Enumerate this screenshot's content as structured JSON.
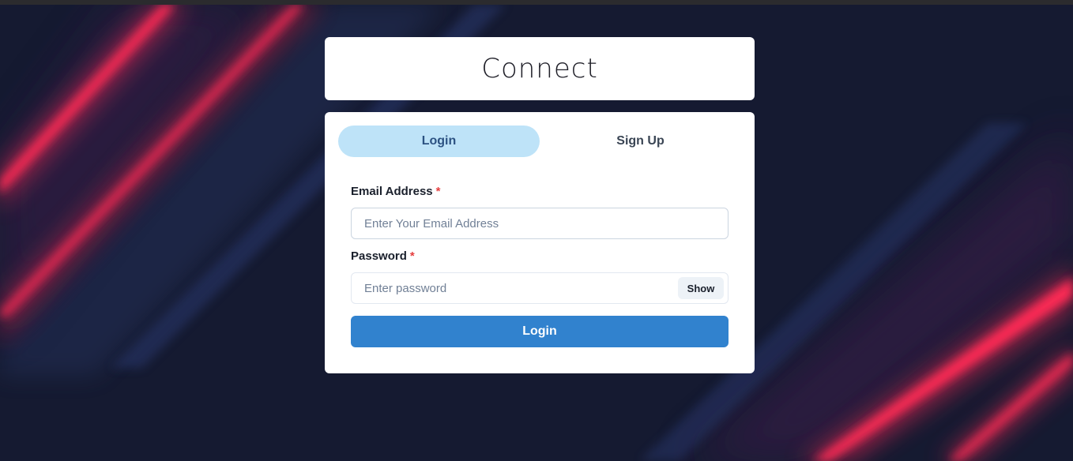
{
  "app": {
    "title": "Connect"
  },
  "tabs": [
    {
      "label": "Login",
      "active": true
    },
    {
      "label": "Sign Up",
      "active": false
    }
  ],
  "form": {
    "email_label": "Email Address",
    "email_placeholder": "Enter Your Email Address",
    "email_value": "",
    "password_label": "Password",
    "password_placeholder": "Enter password",
    "password_value": "",
    "required_mark": "*",
    "show_label": "Show",
    "submit_label": "Login"
  },
  "colors": {
    "background": "#161b33",
    "accent_stripe": "#ff2a55",
    "active_tab": "#bee3f8",
    "primary_button": "#3182ce",
    "required": "#e53e3e"
  }
}
